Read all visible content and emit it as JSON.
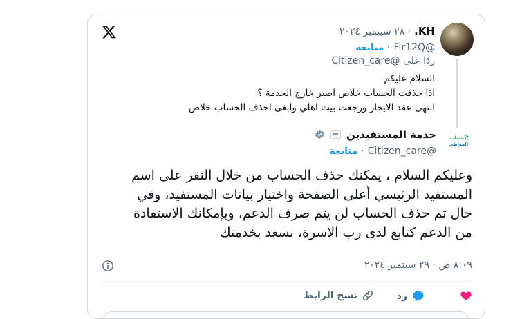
{
  "reply_tweet": {
    "display_name": "KH.",
    "date": "٢٨ سبتمبر ٢٠٢٤",
    "handle": "@Fir12Q",
    "follow_label": "متابعة",
    "replying_to": "ردًا على @Citizen_care",
    "lines": [
      "السلام عليكم",
      "اذا حذفت الحساب خلاص اصير خارج الخدمة ؟",
      "انتهى عقد الايجار ورجعت بيت اهلي وابغى احذف الحساب خلاص"
    ]
  },
  "main_tweet": {
    "display_name": "خدمة المستفيدين",
    "handle": "@Citizen_care",
    "follow_label": "متابعة",
    "logo_text": "حساب المواطن",
    "body": "وعليكم السلام ، يمكنك حذف الحساب من خلال النقر على اسم المستفيد الرئيسي أعلى الصفحة واختيار بيانات المستفيد، وفي حال تم حذف الحساب لن يتم صرف الدعم، وبإمكانك الاستفادة من الدعم كتابع لدى رب الاسرة، نسعد بخدمتك",
    "timestamp": "٨:٠٩ ص · ٢٩ سبتمبر ٢٠٢٤"
  },
  "actions": {
    "reply_label": "رد",
    "copy_link_label": "نسخ الرابط"
  },
  "icons": [
    "x-logo-icon",
    "verified-badge-icon",
    "info-icon",
    "heart-icon",
    "reply-bubble-icon",
    "link-icon"
  ],
  "colors": {
    "accent": "#1d9bf0",
    "like": "#f91880",
    "text": "#0f1419",
    "muted": "#536471"
  }
}
